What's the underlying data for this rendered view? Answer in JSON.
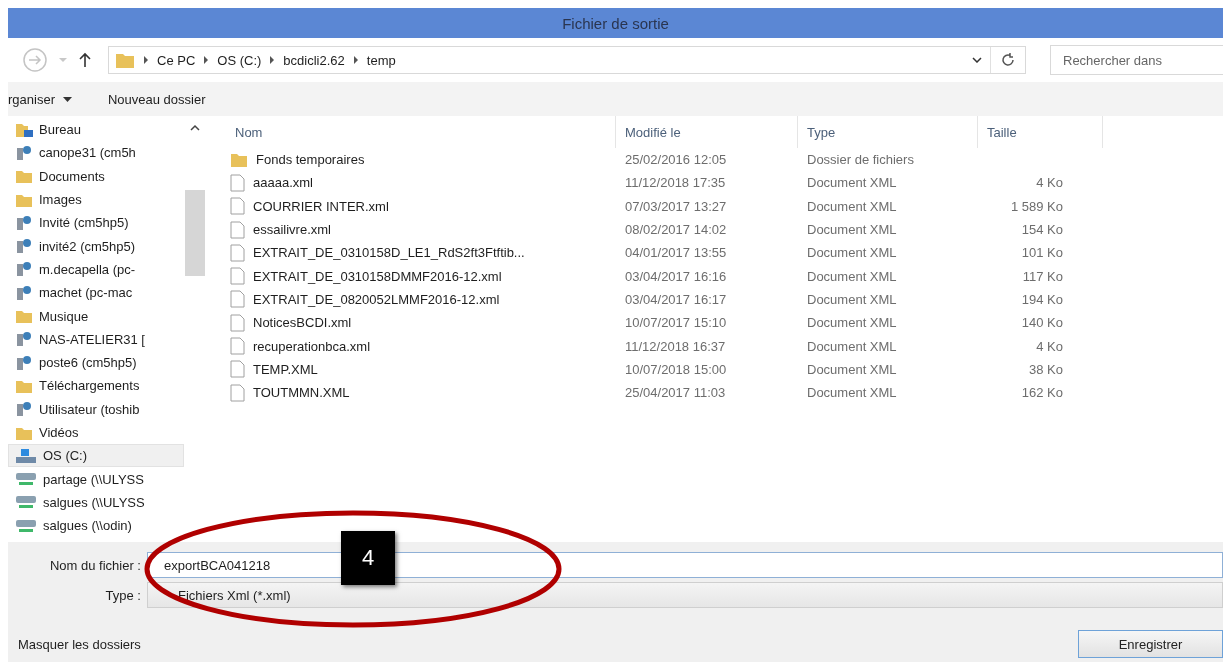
{
  "window": {
    "title": "Fichier de sortie"
  },
  "address": {
    "breadcrumbs": [
      "Ce PC",
      "OS (C:)",
      "bcdicli2.62",
      "temp"
    ]
  },
  "search": {
    "placeholder": "Rechercher dans"
  },
  "toolbar": {
    "organize": "rganiser",
    "new_folder": "Nouveau dossier"
  },
  "sidebar": {
    "items": [
      {
        "label": "Bureau",
        "kind": "desktop",
        "selected": false
      },
      {
        "label": "canope31 (cm5h",
        "kind": "user",
        "selected": false
      },
      {
        "label": "Documents",
        "kind": "folder",
        "selected": false
      },
      {
        "label": "Images",
        "kind": "folder",
        "selected": false
      },
      {
        "label": "Invité (cm5hp5)",
        "kind": "user",
        "selected": false
      },
      {
        "label": "invité2 (cm5hp5)",
        "kind": "user",
        "selected": false
      },
      {
        "label": "m.decapella (pc-",
        "kind": "user",
        "selected": false
      },
      {
        "label": "machet (pc-mac",
        "kind": "user",
        "selected": false
      },
      {
        "label": "Musique",
        "kind": "folder",
        "selected": false
      },
      {
        "label": "NAS-ATELIER31 [",
        "kind": "user",
        "selected": false
      },
      {
        "label": "poste6 (cm5hp5)",
        "kind": "user",
        "selected": false
      },
      {
        "label": "Téléchargements",
        "kind": "folder",
        "selected": false
      },
      {
        "label": "Utilisateur (toshib",
        "kind": "user",
        "selected": false
      },
      {
        "label": "Vidéos",
        "kind": "folder",
        "selected": false
      },
      {
        "label": "OS (C:)",
        "kind": "drive",
        "selected": true
      },
      {
        "label": "partage (\\\\ULYSS",
        "kind": "network",
        "selected": false
      },
      {
        "label": "salgues (\\\\ULYSS",
        "kind": "network",
        "selected": false
      },
      {
        "label": "salgues (\\\\odin)",
        "kind": "network",
        "selected": false
      }
    ]
  },
  "table": {
    "columns": [
      "Nom",
      "Modifié le",
      "Type",
      "Taille"
    ],
    "rows": [
      {
        "kind": "folder",
        "name": "Fonds temporaires",
        "modified": "25/02/2016 12:05",
        "type": "Dossier de fichiers",
        "size": ""
      },
      {
        "kind": "file",
        "name": "aaaaa.xml",
        "modified": "11/12/2018 17:35",
        "type": "Document XML",
        "size": "4 Ko"
      },
      {
        "kind": "file",
        "name": "COURRIER INTER.xml",
        "modified": "07/03/2017 13:27",
        "type": "Document XML",
        "size": "1 589 Ko"
      },
      {
        "kind": "file",
        "name": "essailivre.xml",
        "modified": "08/02/2017 14:02",
        "type": "Document XML",
        "size": "154 Ko"
      },
      {
        "kind": "file",
        "name": "EXTRAIT_DE_0310158D_LE1_RdS2ft3Ftftib...",
        "modified": "04/01/2017 13:55",
        "type": "Document XML",
        "size": "101 Ko"
      },
      {
        "kind": "file",
        "name": "EXTRAIT_DE_0310158DMMF2016-12.xml",
        "modified": "03/04/2017 16:16",
        "type": "Document XML",
        "size": "117 Ko"
      },
      {
        "kind": "file",
        "name": "EXTRAIT_DE_0820052LMMF2016-12.xml",
        "modified": "03/04/2017 16:17",
        "type": "Document XML",
        "size": "194 Ko"
      },
      {
        "kind": "file",
        "name": "NoticesBCDI.xml",
        "modified": "10/07/2017 15:10",
        "type": "Document XML",
        "size": "140 Ko"
      },
      {
        "kind": "file",
        "name": "recuperationbca.xml",
        "modified": "11/12/2018 16:37",
        "type": "Document XML",
        "size": "4 Ko"
      },
      {
        "kind": "file",
        "name": "TEMP.XML",
        "modified": "10/07/2018 15:00",
        "type": "Document XML",
        "size": "38 Ko"
      },
      {
        "kind": "file",
        "name": "TOUTMMN.XML",
        "modified": "25/04/2017 11:03",
        "type": "Document XML",
        "size": "162 Ko"
      }
    ]
  },
  "form": {
    "filename_label": "Nom du fichier :",
    "filename": "exportBCA041218",
    "type_label": "Type :",
    "type_value": "Fichiers Xml (*.xml)"
  },
  "footer": {
    "hide_folders": "Masquer les dossiers",
    "save": "Enregistrer"
  },
  "annotation": {
    "badge": "4"
  }
}
